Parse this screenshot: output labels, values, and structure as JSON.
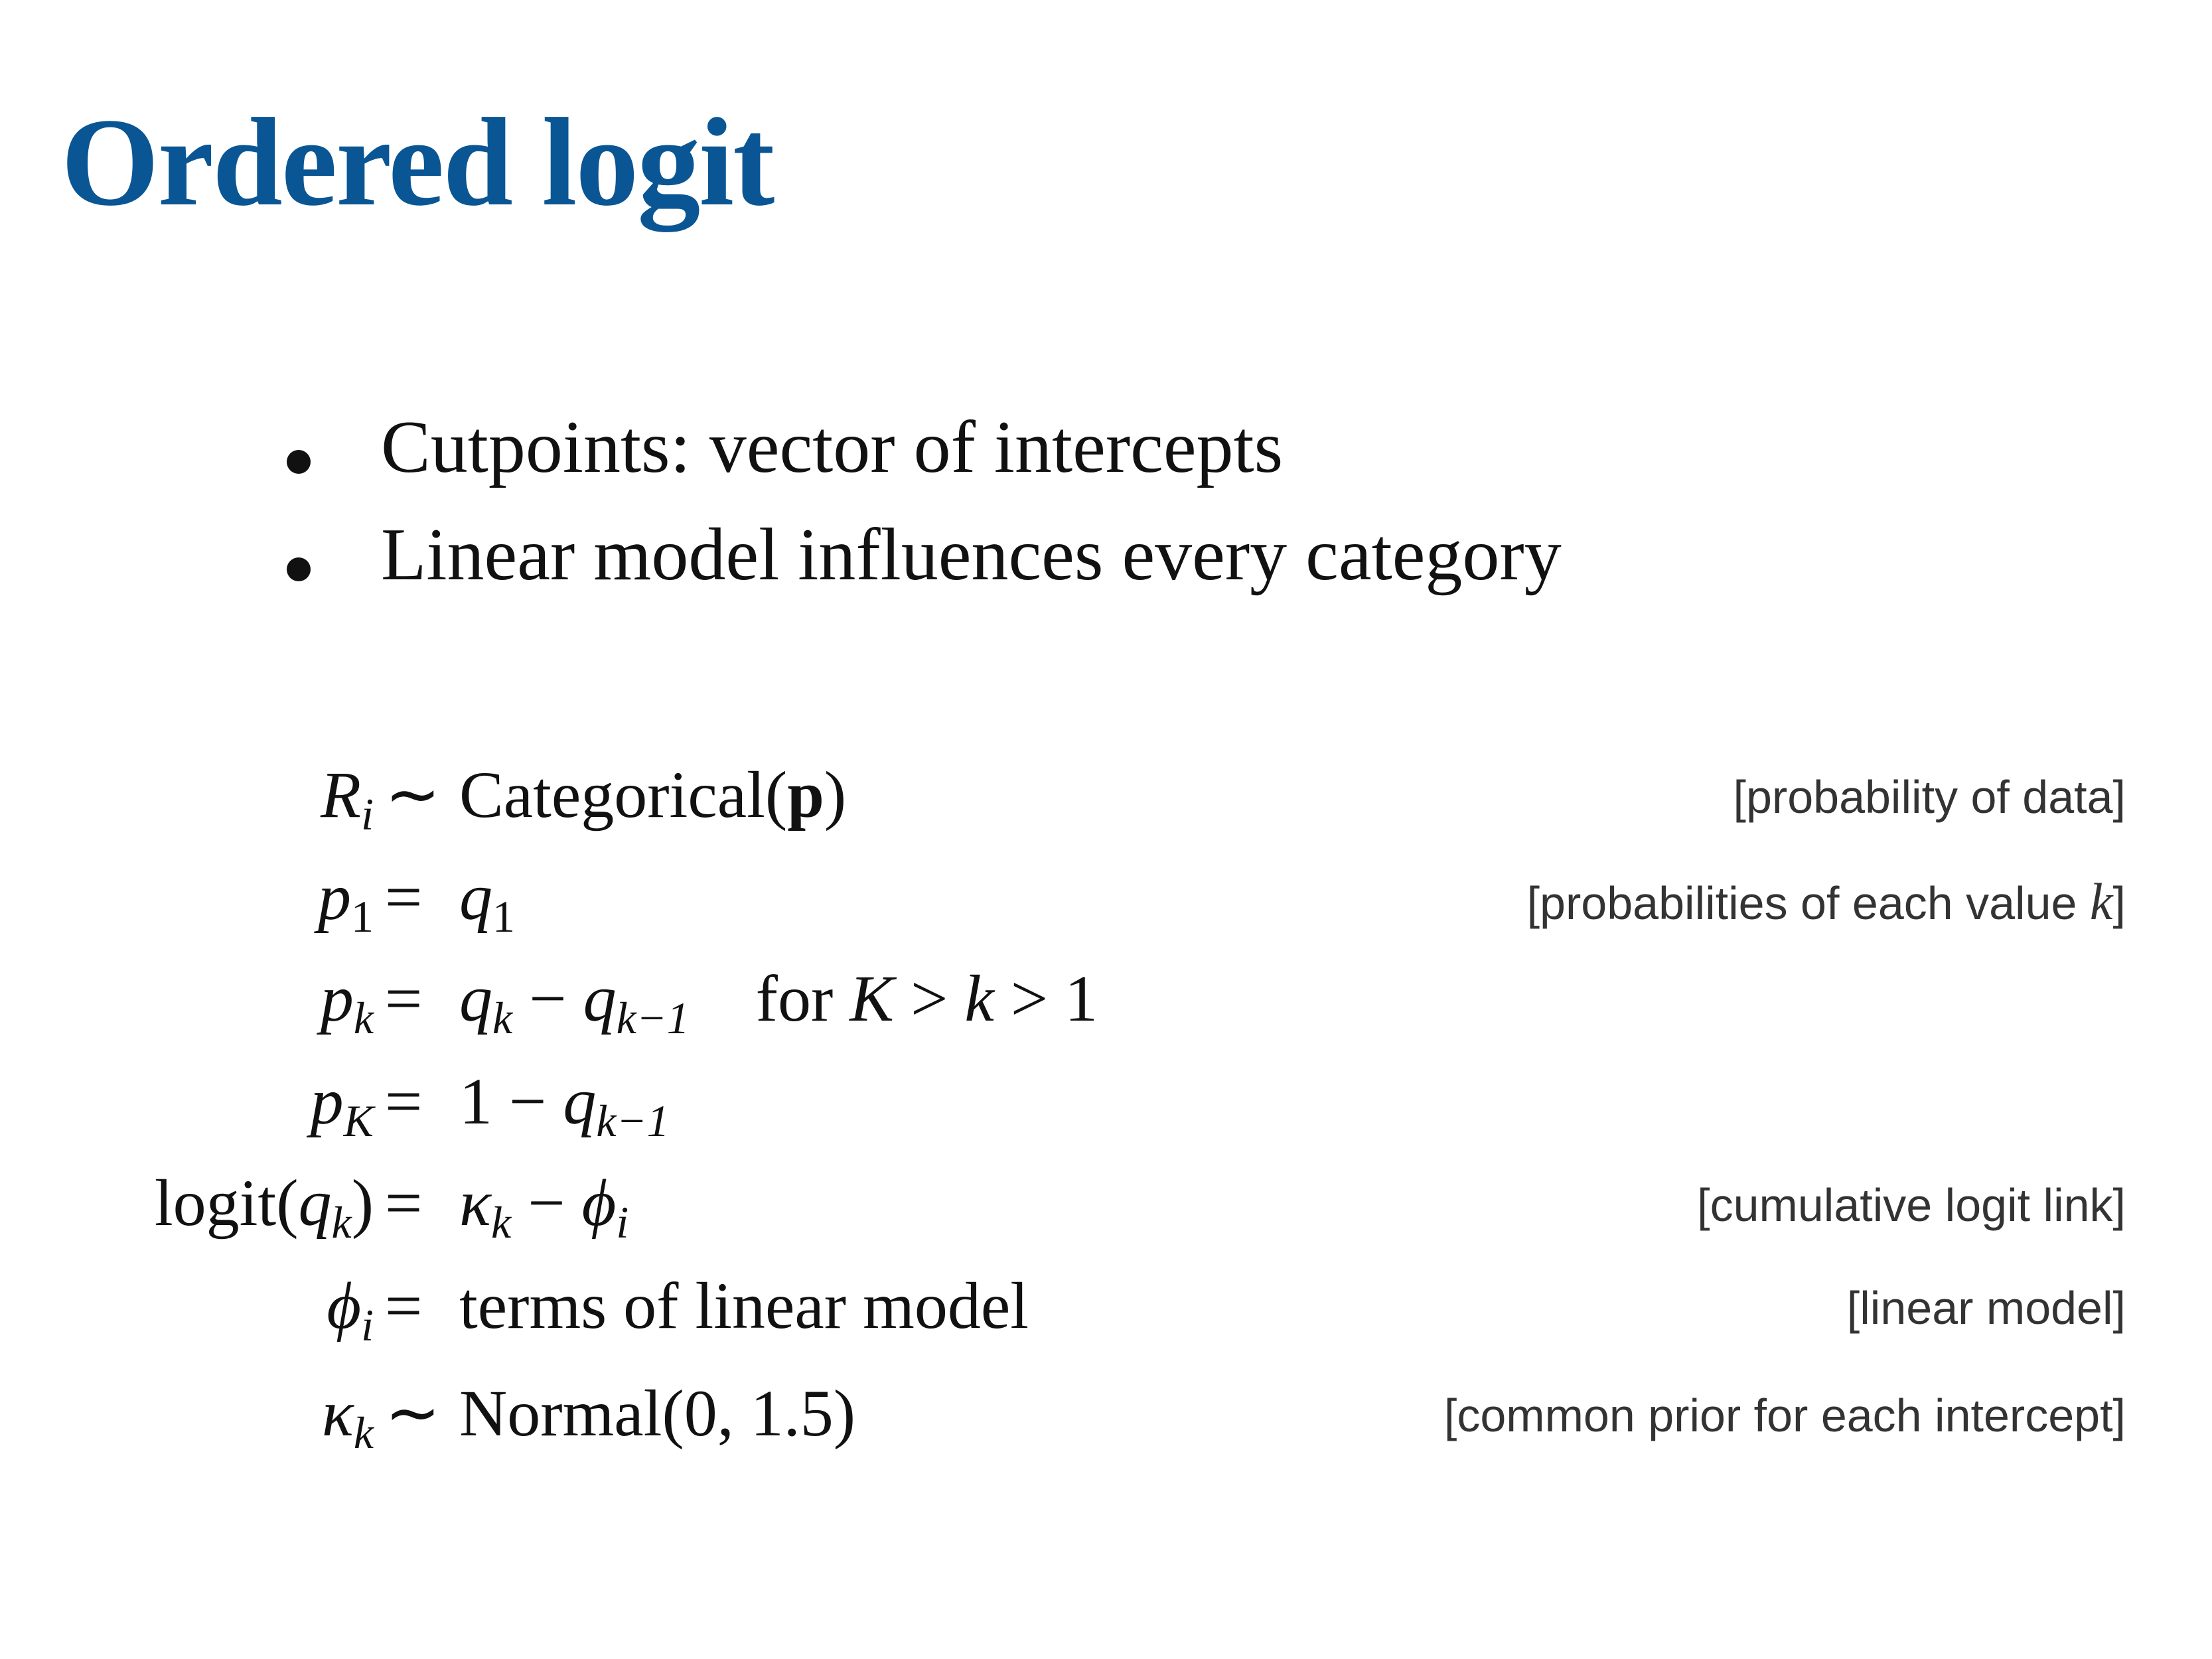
{
  "title": {
    "text": "Ordered logit",
    "color": "#0a5694"
  },
  "bullets": [
    "Cutpoints: vector of intercepts",
    "Linear model influences every category"
  ],
  "equations": {
    "tilde": "∼",
    "equals": "=",
    "minus": "−",
    "row1": {
      "R": "R",
      "i": "i",
      "categorical": "Categorical(",
      "p": "p",
      "close": ")",
      "annotation": "[probability of data]"
    },
    "row2": {
      "p": "p",
      "sub1": "1",
      "q": "q",
      "subq": "1",
      "annotation_prefix": "[probabilities of each value ",
      "annotation_k": "k",
      "annotation_suffix": "]"
    },
    "row3": {
      "p": "p",
      "k": "k",
      "q": "q",
      "k2": "k",
      "q2": "q",
      "kminus1": "k−1",
      "for": "for ",
      "K": "K",
      "gt1": " > ",
      "k3": "k",
      "gt2": " > 1"
    },
    "row4": {
      "p": "p",
      "K": "K",
      "one": "1 ",
      "q": "q",
      "kminus1": "k−1"
    },
    "row5": {
      "logit_open": "logit(",
      "q": "q",
      "k": "k",
      "close": ")",
      "kappa": "κ",
      "k2": "k",
      "phi": "ϕ",
      "i": "i",
      "annotation": "[cumulative logit link]"
    },
    "row6": {
      "phi": "ϕ",
      "i": "i",
      "terms": "terms of linear model",
      "annotation": "[linear model]"
    },
    "row7": {
      "kappa": "κ",
      "k": "k",
      "normal": "Normal(0, 1.5)",
      "annotation": "[common prior for each intercept]"
    }
  }
}
